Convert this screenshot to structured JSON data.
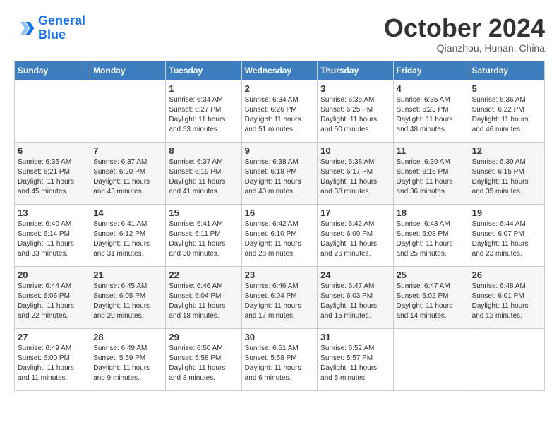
{
  "header": {
    "logo_line1": "General",
    "logo_line2": "Blue",
    "month": "October 2024",
    "location": "Qianzhou, Hunan, China"
  },
  "weekdays": [
    "Sunday",
    "Monday",
    "Tuesday",
    "Wednesday",
    "Thursday",
    "Friday",
    "Saturday"
  ],
  "weeks": [
    [
      {
        "day": "",
        "info": ""
      },
      {
        "day": "",
        "info": ""
      },
      {
        "day": "1",
        "info": "Sunrise: 6:34 AM\nSunset: 6:27 PM\nDaylight: 11 hours and 53 minutes."
      },
      {
        "day": "2",
        "info": "Sunrise: 6:34 AM\nSunset: 6:26 PM\nDaylight: 11 hours and 51 minutes."
      },
      {
        "day": "3",
        "info": "Sunrise: 6:35 AM\nSunset: 6:25 PM\nDaylight: 11 hours and 50 minutes."
      },
      {
        "day": "4",
        "info": "Sunrise: 6:35 AM\nSunset: 6:23 PM\nDaylight: 11 hours and 48 minutes."
      },
      {
        "day": "5",
        "info": "Sunrise: 6:36 AM\nSunset: 6:22 PM\nDaylight: 11 hours and 46 minutes."
      }
    ],
    [
      {
        "day": "6",
        "info": "Sunrise: 6:36 AM\nSunset: 6:21 PM\nDaylight: 11 hours and 45 minutes."
      },
      {
        "day": "7",
        "info": "Sunrise: 6:37 AM\nSunset: 6:20 PM\nDaylight: 11 hours and 43 minutes."
      },
      {
        "day": "8",
        "info": "Sunrise: 6:37 AM\nSunset: 6:19 PM\nDaylight: 11 hours and 41 minutes."
      },
      {
        "day": "9",
        "info": "Sunrise: 6:38 AM\nSunset: 6:18 PM\nDaylight: 11 hours and 40 minutes."
      },
      {
        "day": "10",
        "info": "Sunrise: 6:38 AM\nSunset: 6:17 PM\nDaylight: 11 hours and 38 minutes."
      },
      {
        "day": "11",
        "info": "Sunrise: 6:39 AM\nSunset: 6:16 PM\nDaylight: 11 hours and 36 minutes."
      },
      {
        "day": "12",
        "info": "Sunrise: 6:39 AM\nSunset: 6:15 PM\nDaylight: 11 hours and 35 minutes."
      }
    ],
    [
      {
        "day": "13",
        "info": "Sunrise: 6:40 AM\nSunset: 6:14 PM\nDaylight: 11 hours and 33 minutes."
      },
      {
        "day": "14",
        "info": "Sunrise: 6:41 AM\nSunset: 6:12 PM\nDaylight: 11 hours and 31 minutes."
      },
      {
        "day": "15",
        "info": "Sunrise: 6:41 AM\nSunset: 6:11 PM\nDaylight: 11 hours and 30 minutes."
      },
      {
        "day": "16",
        "info": "Sunrise: 6:42 AM\nSunset: 6:10 PM\nDaylight: 11 hours and 28 minutes."
      },
      {
        "day": "17",
        "info": "Sunrise: 6:42 AM\nSunset: 6:09 PM\nDaylight: 11 hours and 26 minutes."
      },
      {
        "day": "18",
        "info": "Sunrise: 6:43 AM\nSunset: 6:08 PM\nDaylight: 11 hours and 25 minutes."
      },
      {
        "day": "19",
        "info": "Sunrise: 6:44 AM\nSunset: 6:07 PM\nDaylight: 11 hours and 23 minutes."
      }
    ],
    [
      {
        "day": "20",
        "info": "Sunrise: 6:44 AM\nSunset: 6:06 PM\nDaylight: 11 hours and 22 minutes."
      },
      {
        "day": "21",
        "info": "Sunrise: 6:45 AM\nSunset: 6:05 PM\nDaylight: 11 hours and 20 minutes."
      },
      {
        "day": "22",
        "info": "Sunrise: 6:46 AM\nSunset: 6:04 PM\nDaylight: 11 hours and 18 minutes."
      },
      {
        "day": "23",
        "info": "Sunrise: 6:46 AM\nSunset: 6:04 PM\nDaylight: 11 hours and 17 minutes."
      },
      {
        "day": "24",
        "info": "Sunrise: 6:47 AM\nSunset: 6:03 PM\nDaylight: 11 hours and 15 minutes."
      },
      {
        "day": "25",
        "info": "Sunrise: 6:47 AM\nSunset: 6:02 PM\nDaylight: 11 hours and 14 minutes."
      },
      {
        "day": "26",
        "info": "Sunrise: 6:48 AM\nSunset: 6:01 PM\nDaylight: 11 hours and 12 minutes."
      }
    ],
    [
      {
        "day": "27",
        "info": "Sunrise: 6:49 AM\nSunset: 6:00 PM\nDaylight: 11 hours and 11 minutes."
      },
      {
        "day": "28",
        "info": "Sunrise: 6:49 AM\nSunset: 5:59 PM\nDaylight: 11 hours and 9 minutes."
      },
      {
        "day": "29",
        "info": "Sunrise: 6:50 AM\nSunset: 5:58 PM\nDaylight: 11 hours and 8 minutes."
      },
      {
        "day": "30",
        "info": "Sunrise: 6:51 AM\nSunset: 5:58 PM\nDaylight: 11 hours and 6 minutes."
      },
      {
        "day": "31",
        "info": "Sunrise: 6:52 AM\nSunset: 5:57 PM\nDaylight: 11 hours and 5 minutes."
      },
      {
        "day": "",
        "info": ""
      },
      {
        "day": "",
        "info": ""
      }
    ]
  ]
}
